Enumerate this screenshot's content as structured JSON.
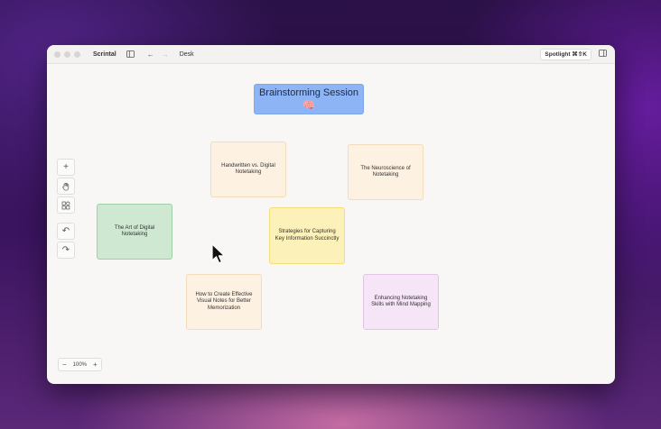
{
  "window": {
    "app_name": "Scrintal",
    "doc_title": "Desk",
    "spotlight_label": "Spotlight ⌘⇧K"
  },
  "canvas": {
    "title_card": "Brainstorming Session 🧠",
    "notes": [
      {
        "id": "handwritten",
        "text": "Handwritten vs. Digital Notetaking",
        "color": "#fdf1e1"
      },
      {
        "id": "neuroscience",
        "text": "The Neuroscience of Notetaking",
        "color": "#fdf1e1"
      },
      {
        "id": "art-digital",
        "text": "The Art of Digital Notetaking",
        "color": "#cfe8d2"
      },
      {
        "id": "strategies",
        "text": "Strategies for Capturing Key Information Succinctly",
        "color": "#fcf1b8"
      },
      {
        "id": "visual-notes",
        "text": "How to Create Effective Visual Notes for Better Memorization",
        "color": "#fdf1e1"
      },
      {
        "id": "mind-mapping",
        "text": "Enhancing Notetaking Skills with Mind Mapping",
        "color": "#f6e4f7"
      }
    ]
  },
  "toolbar": {
    "icons": [
      "plus-icon",
      "hand-icon",
      "shapes-icon",
      "undo-icon",
      "redo-icon"
    ]
  },
  "zoom": {
    "minus": "−",
    "level": "100%",
    "plus": "+"
  }
}
